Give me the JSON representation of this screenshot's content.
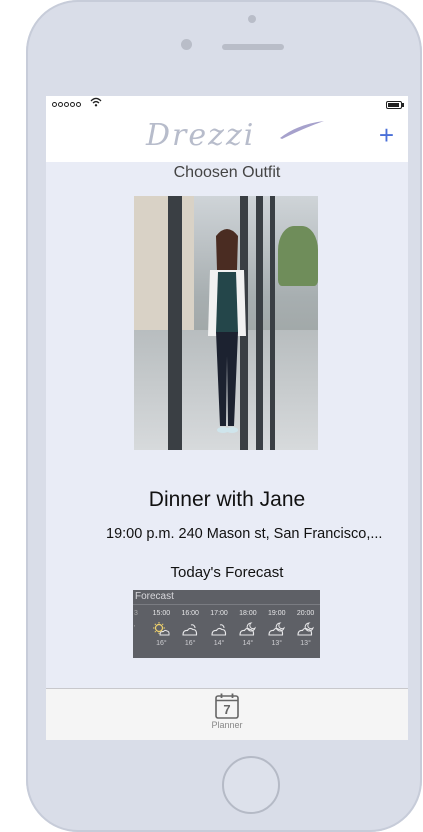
{
  "status_bar": {
    "signal_icon": "signal-dots-icon",
    "wifi_icon": "wifi-icon",
    "battery_icon": "battery-icon"
  },
  "nav": {
    "logo_text": "Drezzi",
    "add_icon": "plus-icon",
    "add_label": "+"
  },
  "outfit": {
    "title": "Choosen Outfit",
    "photo_icon": "outfit-photo"
  },
  "event": {
    "title": "Dinner with Jane",
    "details": "19:00 p.m.  240 Mason st, San Francisco,..."
  },
  "forecast": {
    "title": "Today's Forecast",
    "widget_header": "Forecast",
    "leading_edge": {
      "hour": "3",
      "temp": "'"
    },
    "hours": [
      {
        "time": "15:00",
        "icon": "sun-cloud-icon",
        "temp": "16°"
      },
      {
        "time": "16:00",
        "icon": "cloud-sun-icon",
        "temp": "16°"
      },
      {
        "time": "17:00",
        "icon": "cloud-sun-icon",
        "temp": "14°"
      },
      {
        "time": "18:00",
        "icon": "cloud-moon-icon",
        "temp": "14°"
      },
      {
        "time": "19:00",
        "icon": "cloud-moon-icon",
        "temp": "13°"
      },
      {
        "time": "20:00",
        "icon": "cloud-moon-icon",
        "temp": "13°"
      }
    ]
  },
  "tab_bar": {
    "items": [
      {
        "label": "Planner",
        "icon": "calendar-icon",
        "day": "7"
      }
    ]
  },
  "colors": {
    "accent": "#4a6fd8",
    "screen_bg": "#e9ecf6",
    "device_frame": "#d9dde8"
  }
}
